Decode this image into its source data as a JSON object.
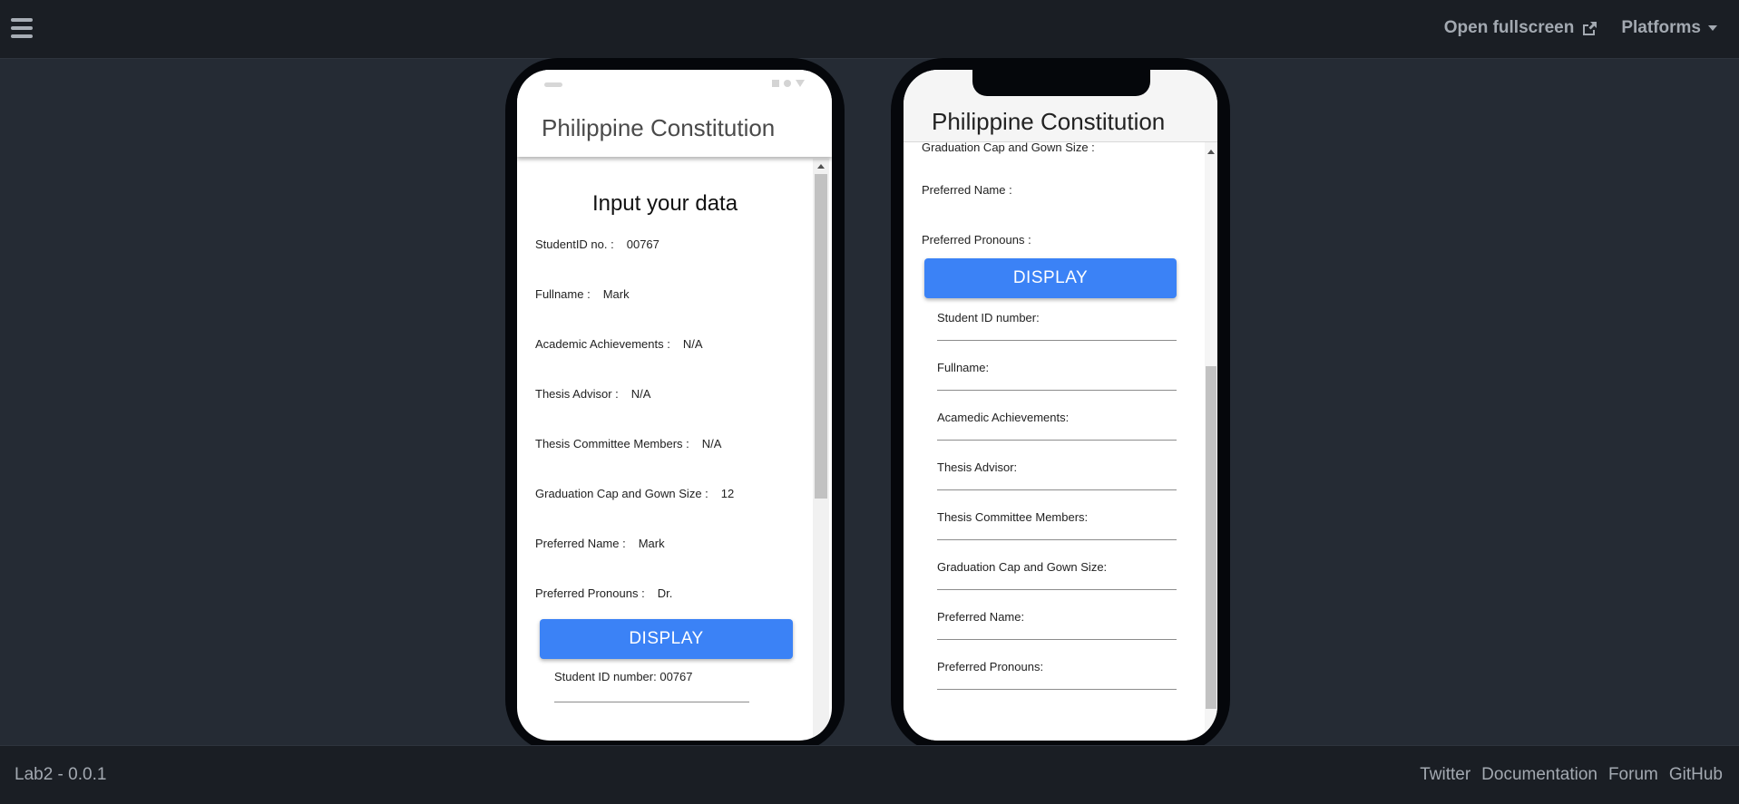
{
  "topbar": {
    "open_fullscreen": "Open fullscreen",
    "platforms": "Platforms"
  },
  "footer": {
    "version": "Lab2 - 0.0.1",
    "links": [
      "Twitter",
      "Documentation",
      "Forum",
      "GitHub"
    ]
  },
  "phone1": {
    "title": "Philippine Constitution",
    "heading": "Input your data",
    "fields": [
      {
        "label": "StudentID no. :",
        "value": "00767"
      },
      {
        "label": "Fullname :",
        "value": "Mark"
      },
      {
        "label": "Academic Achievements :",
        "value": "N/A"
      },
      {
        "label": "Thesis Advisor :",
        "value": "N/A"
      },
      {
        "label": "Thesis Committee Members :",
        "value": "N/A"
      },
      {
        "label": "Graduation Cap and Gown Size :",
        "value": "12"
      },
      {
        "label": "Preferred Name :",
        "value": "Mark"
      },
      {
        "label": "Preferred Pronouns :",
        "value": "Dr."
      }
    ],
    "button": "DISPLAY",
    "result_first": "Student ID number: 00767"
  },
  "phone2": {
    "title": "Philippine Constitution",
    "fields": [
      "Graduation Cap and Gown Size :",
      "Preferred Name :",
      "Preferred Pronouns :"
    ],
    "button": "DISPLAY",
    "results": [
      "Student ID number:",
      "Fullname:",
      "Acamedic Achievements:",
      "Thesis Advisor:",
      "Thesis Committee Members:",
      "Graduation Cap and Gown Size:",
      "Preferred Name:",
      "Preferred Pronouns:"
    ]
  },
  "colors": {
    "background": "#252b34",
    "bar": "#1a1e24",
    "button": "#3b82f6"
  },
  "icons": [
    "menu-icon",
    "external-link-icon",
    "caret-down-icon"
  ]
}
